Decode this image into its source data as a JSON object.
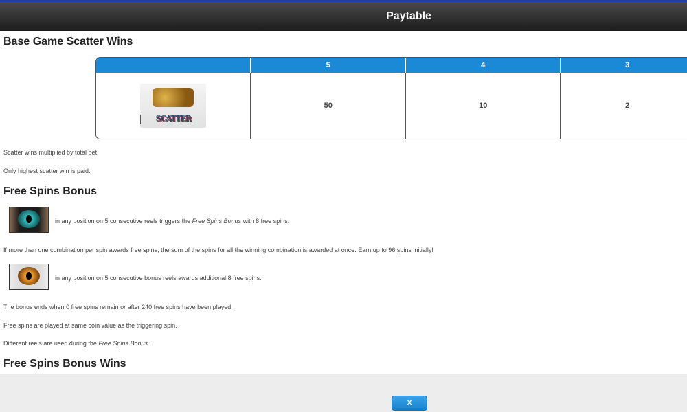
{
  "header": {
    "title": "Paytable"
  },
  "sections": {
    "scatter_title": "Base Game Scatter Wins",
    "free_spins_title": "Free Spins Bonus",
    "free_spins_wins_title": "Free Spins Bonus Wins"
  },
  "scatter_table": {
    "headers": [
      "",
      "5",
      "4",
      "3"
    ],
    "symbol_label": "SCATTER",
    "payouts": [
      "50",
      "10",
      "2"
    ]
  },
  "notes": {
    "scatter_1": "Scatter wins multiplied by total bet.",
    "scatter_2": "Only highest scatter win is paid.",
    "teal_eye_pre": "in any position on 5 consecutive reels triggers the ",
    "teal_eye_em": "Free Spins Bonus",
    "teal_eye_post": " with 8 free spins.",
    "combo": "If more than one combination per spin awards free spins, the sum of the spins for all the winning combination is awarded at once. Earn up to 96 spins initially!",
    "amber_eye": "in any position on 5 consecutive bonus reels awards additional 8 free spins.",
    "bonus_end": "The bonus ends when 0 free spins remain or after 240 free spins have been played.",
    "coin_value": "Free spins are played at same coin value as the triggering spin.",
    "reels_pre": "Different reels are used during the ",
    "reels_em": "Free Spins Bonus",
    "reels_post": "."
  },
  "footer": {
    "close_label": "X"
  },
  "colors": {
    "table_header": "#1a8ad6",
    "button": "#1682cc",
    "header_bg": "#2a2a2a"
  }
}
